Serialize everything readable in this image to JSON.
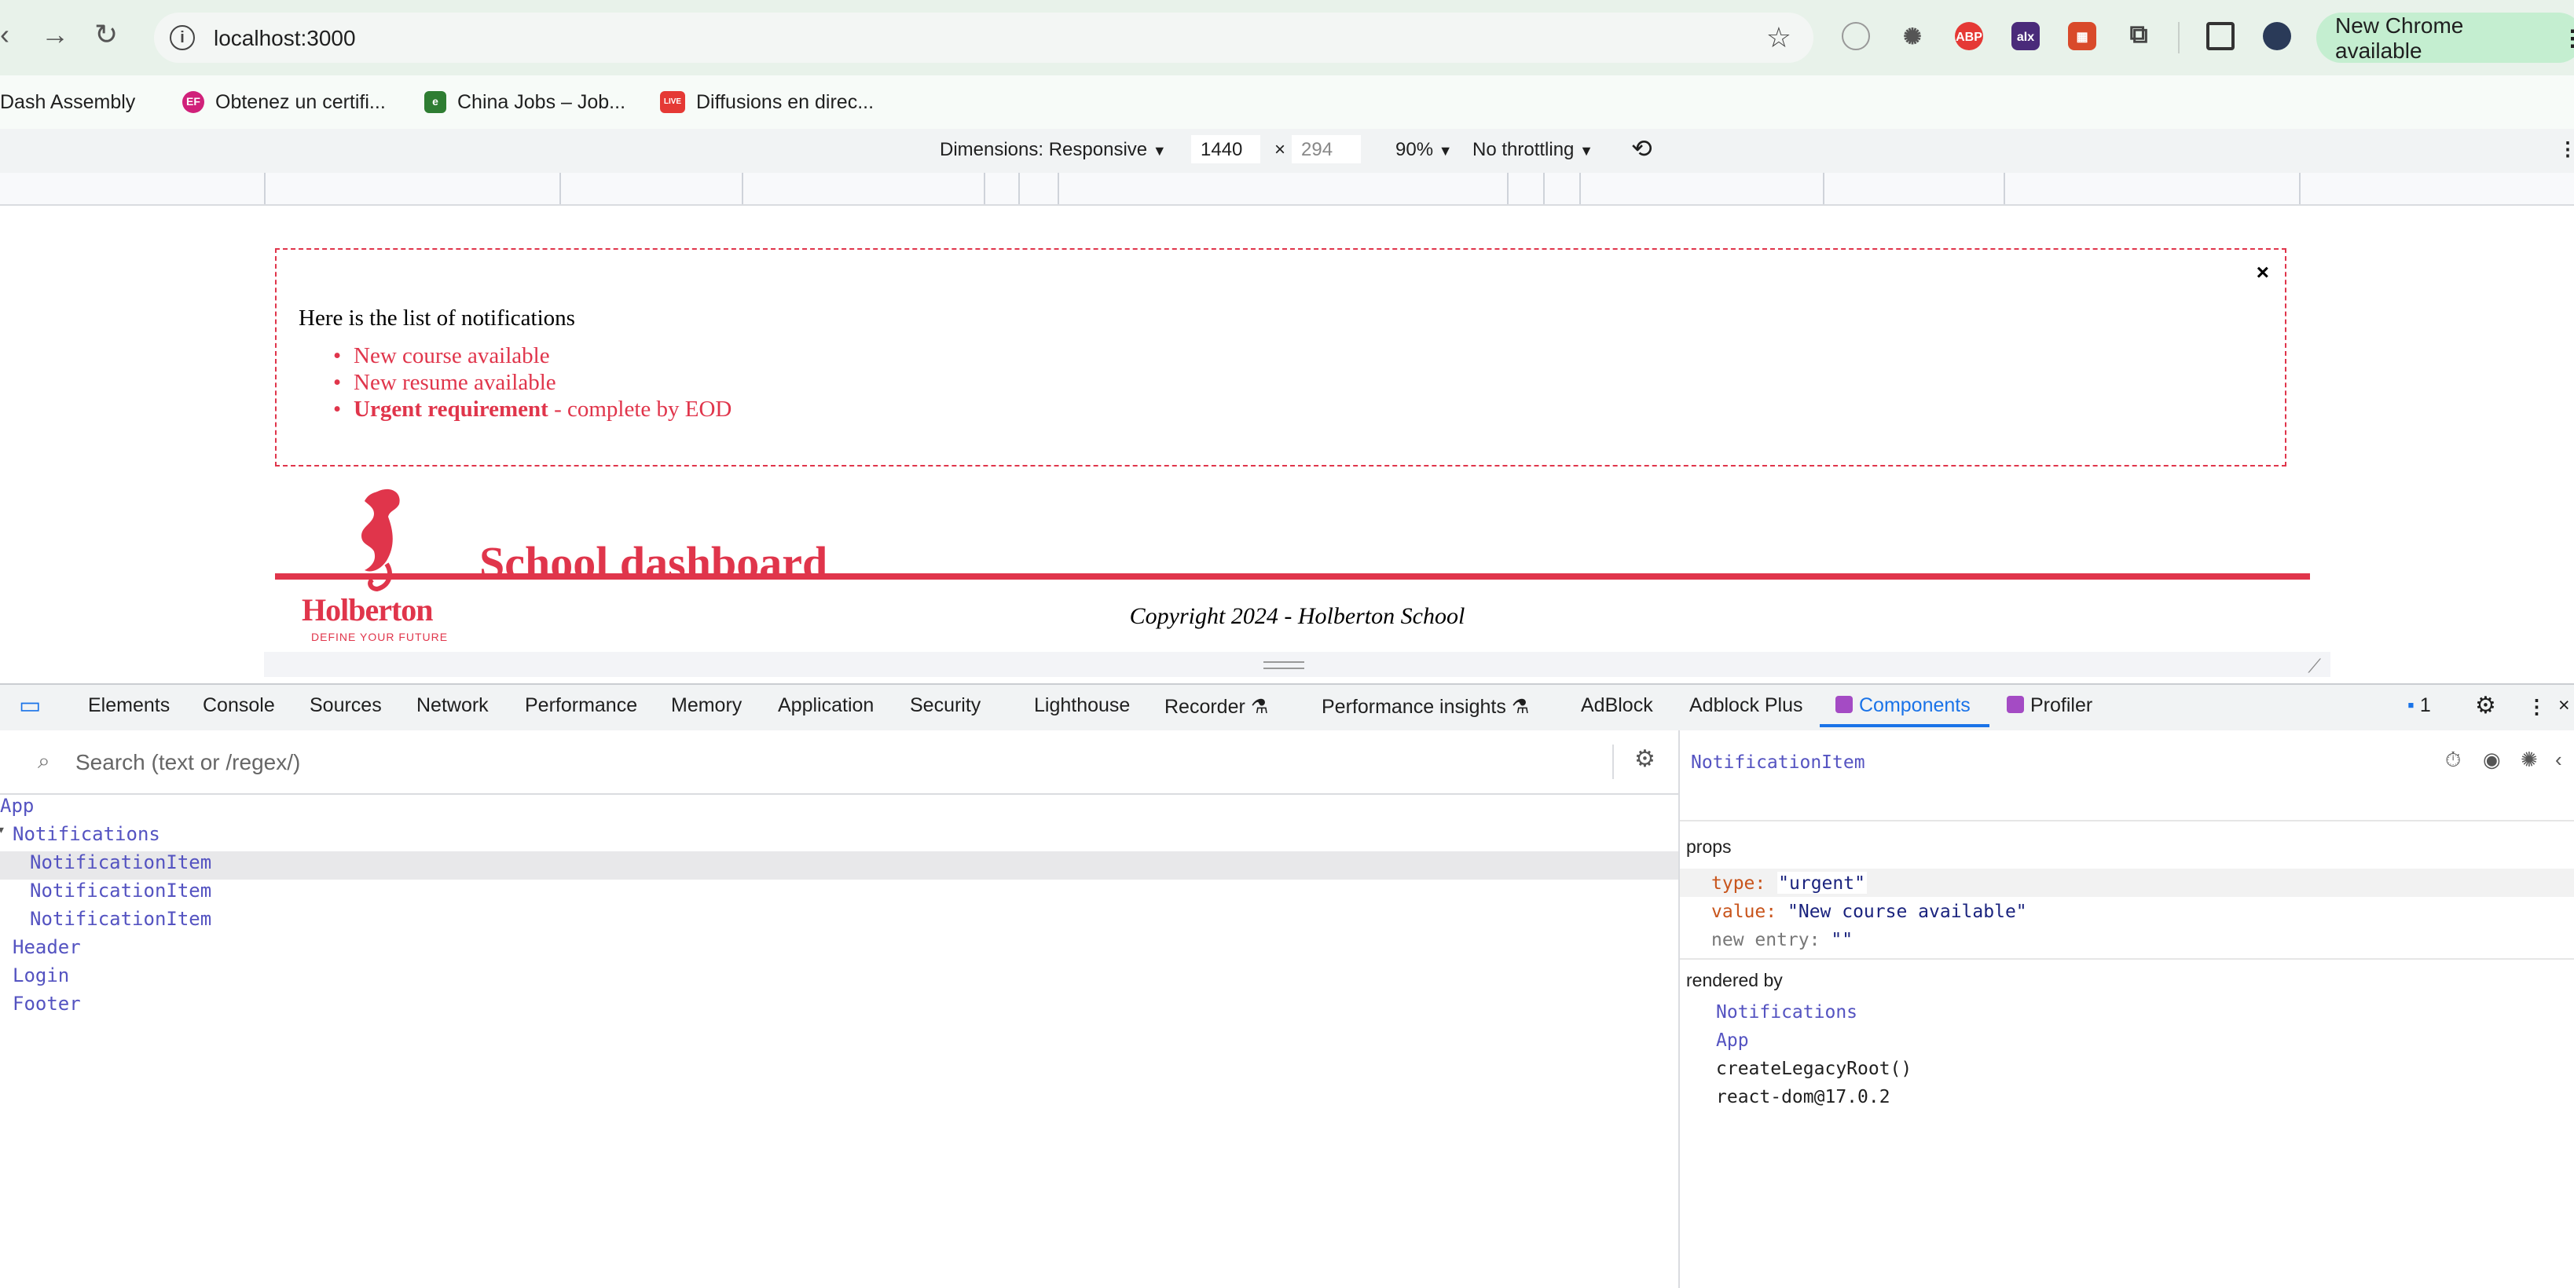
{
  "browser": {
    "url": "localhost:3000",
    "update_button": "New Chrome available",
    "bookmarks": [
      {
        "label": "Dash Assembly"
      },
      {
        "label": "Obtenez un certifi..."
      },
      {
        "label": "China Jobs – Job..."
      },
      {
        "label": "Diffusions en direc..."
      }
    ],
    "extensions": [
      "compass-icon",
      "bug-icon",
      "abp-icon",
      "alx-icon",
      "ext-red-icon",
      "puzzle-icon",
      "sidepanel-icon",
      "profile-avatar"
    ],
    "ext_labels": {
      "abp": "ABP",
      "alx": "alx"
    },
    "bookmark_favicons": {
      "ef": "EF",
      "live": "LIVE"
    }
  },
  "device_toolbar": {
    "dimensions_label": "Dimensions: Responsive",
    "width": "1440",
    "times": "×",
    "height_placeholder": "294",
    "zoom": "90%",
    "throttling": "No throttling"
  },
  "page": {
    "notifications_title": "Here is the list of notifications",
    "close_symbol": "×",
    "items": [
      {
        "text": "New course available"
      },
      {
        "text": "New resume available"
      },
      {
        "bold": "Urgent requirement",
        "text": " - complete by EOD"
      }
    ],
    "header_title": "School dashboard",
    "logo_name": "Holberton",
    "logo_tagline": "DEFINE YOUR FUTURE",
    "footer": "Copyright 2024 - Holberton School"
  },
  "devtools": {
    "tabs": [
      "Elements",
      "Console",
      "Sources",
      "Network",
      "Performance",
      "Memory",
      "Application",
      "Security",
      "Lighthouse",
      "Recorder",
      "Performance insights",
      "AdBlock",
      "Adblock Plus",
      "Components",
      "Profiler"
    ],
    "active_tab": "Components",
    "issues_count": "1",
    "search_placeholder": "Search (text or /regex/)",
    "tree": [
      {
        "label": "App",
        "depth": 0
      },
      {
        "label": "Notifications",
        "depth": 1,
        "arrow": "▾"
      },
      {
        "label": "NotificationItem",
        "depth": 2,
        "selected": true
      },
      {
        "label": "NotificationItem",
        "depth": 2
      },
      {
        "label": "NotificationItem",
        "depth": 2
      },
      {
        "label": "Header",
        "depth": 1
      },
      {
        "label": "Login",
        "depth": 1
      },
      {
        "label": "Footer",
        "depth": 1
      }
    ],
    "selected_component": "NotificationItem",
    "props_heading": "props",
    "props": [
      {
        "key": "type",
        "value": "\"urgent\""
      },
      {
        "key": "value",
        "value": "\"New course available\""
      },
      {
        "key": "new entry",
        "value": "\"\""
      }
    ],
    "rendered_by_heading": "rendered by",
    "rendered_by": [
      {
        "label": "Notifications",
        "link": true
      },
      {
        "label": "App",
        "link": true
      },
      {
        "label": "createLegacyRoot()",
        "link": false
      },
      {
        "label": "react-dom@17.0.2",
        "link": false
      }
    ]
  },
  "colors": {
    "holberton_red": "#e0354b",
    "devtools_blue": "#1a73e8",
    "component_purple": "#5453c1",
    "chrome_green": "#c4eed0"
  }
}
